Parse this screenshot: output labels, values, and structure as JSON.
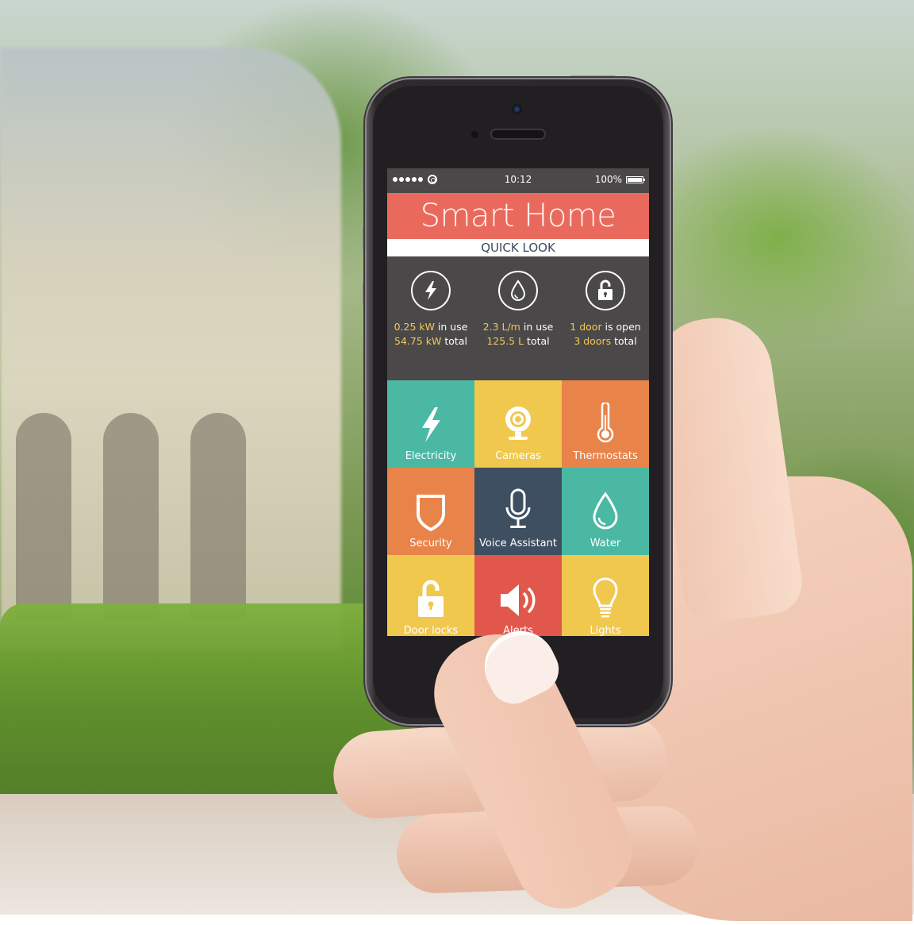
{
  "status_bar": {
    "signal_dots": 5,
    "wifi_icon": "wifi-icon",
    "time": "10:12",
    "battery_percent": "100%",
    "battery_level": 1.0
  },
  "app": {
    "title": "Smart Home",
    "subtitle": "QUICK LOOK",
    "accent_color": "#e96a5d"
  },
  "quick_look": [
    {
      "icon": "lightning-icon",
      "line1_value": "0.25 kW",
      "line1_text": " in use",
      "line2_value": "54.75 kW",
      "line2_text": " total"
    },
    {
      "icon": "water-drop-icon",
      "line1_value": "2.3 L/m",
      "line1_text": " in use",
      "line2_value": "125.5 L",
      "line2_text": " total"
    },
    {
      "icon": "unlocked-padlock-icon",
      "line1_value": "1 door",
      "line1_text": " is open",
      "line2_value": "3 doors",
      "line2_text": " total"
    }
  ],
  "tiles": [
    {
      "label": "Electricity",
      "icon": "lightning-icon",
      "color": "#4bb8a3"
    },
    {
      "label": "Cameras",
      "icon": "webcam-icon",
      "color": "#f0c84e"
    },
    {
      "label": "Thermostats",
      "icon": "thermometer-icon",
      "color": "#e8834a"
    },
    {
      "label": "Security",
      "icon": "shield-icon",
      "color": "#e8834a"
    },
    {
      "label": "Voice Assistant",
      "icon": "microphone-icon",
      "color": "#3d4f60"
    },
    {
      "label": "Water",
      "icon": "water-drop-icon",
      "color": "#4bb8a3"
    },
    {
      "label": "Door locks",
      "icon": "unlocked-padlock-icon",
      "color": "#f0c84e"
    },
    {
      "label": "Alerts",
      "icon": "speaker-icon",
      "color": "#e2574c"
    },
    {
      "label": "Lights",
      "icon": "light-bulb-icon",
      "color": "#f0c84e"
    }
  ]
}
